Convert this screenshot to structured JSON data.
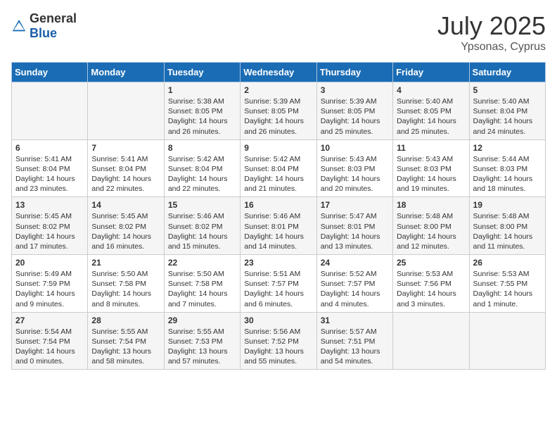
{
  "header": {
    "logo_general": "General",
    "logo_blue": "Blue",
    "month": "July 2025",
    "location": "Ypsonas, Cyprus"
  },
  "days_of_week": [
    "Sunday",
    "Monday",
    "Tuesday",
    "Wednesday",
    "Thursday",
    "Friday",
    "Saturday"
  ],
  "weeks": [
    [
      {
        "day": "",
        "content": ""
      },
      {
        "day": "",
        "content": ""
      },
      {
        "day": "1",
        "sunrise": "Sunrise: 5:38 AM",
        "sunset": "Sunset: 8:05 PM",
        "daylight": "Daylight: 14 hours and 26 minutes."
      },
      {
        "day": "2",
        "sunrise": "Sunrise: 5:39 AM",
        "sunset": "Sunset: 8:05 PM",
        "daylight": "Daylight: 14 hours and 26 minutes."
      },
      {
        "day": "3",
        "sunrise": "Sunrise: 5:39 AM",
        "sunset": "Sunset: 8:05 PM",
        "daylight": "Daylight: 14 hours and 25 minutes."
      },
      {
        "day": "4",
        "sunrise": "Sunrise: 5:40 AM",
        "sunset": "Sunset: 8:05 PM",
        "daylight": "Daylight: 14 hours and 25 minutes."
      },
      {
        "day": "5",
        "sunrise": "Sunrise: 5:40 AM",
        "sunset": "Sunset: 8:04 PM",
        "daylight": "Daylight: 14 hours and 24 minutes."
      }
    ],
    [
      {
        "day": "6",
        "sunrise": "Sunrise: 5:41 AM",
        "sunset": "Sunset: 8:04 PM",
        "daylight": "Daylight: 14 hours and 23 minutes."
      },
      {
        "day": "7",
        "sunrise": "Sunrise: 5:41 AM",
        "sunset": "Sunset: 8:04 PM",
        "daylight": "Daylight: 14 hours and 22 minutes."
      },
      {
        "day": "8",
        "sunrise": "Sunrise: 5:42 AM",
        "sunset": "Sunset: 8:04 PM",
        "daylight": "Daylight: 14 hours and 22 minutes."
      },
      {
        "day": "9",
        "sunrise": "Sunrise: 5:42 AM",
        "sunset": "Sunset: 8:04 PM",
        "daylight": "Daylight: 14 hours and 21 minutes."
      },
      {
        "day": "10",
        "sunrise": "Sunrise: 5:43 AM",
        "sunset": "Sunset: 8:03 PM",
        "daylight": "Daylight: 14 hours and 20 minutes."
      },
      {
        "day": "11",
        "sunrise": "Sunrise: 5:43 AM",
        "sunset": "Sunset: 8:03 PM",
        "daylight": "Daylight: 14 hours and 19 minutes."
      },
      {
        "day": "12",
        "sunrise": "Sunrise: 5:44 AM",
        "sunset": "Sunset: 8:03 PM",
        "daylight": "Daylight: 14 hours and 18 minutes."
      }
    ],
    [
      {
        "day": "13",
        "sunrise": "Sunrise: 5:45 AM",
        "sunset": "Sunset: 8:02 PM",
        "daylight": "Daylight: 14 hours and 17 minutes."
      },
      {
        "day": "14",
        "sunrise": "Sunrise: 5:45 AM",
        "sunset": "Sunset: 8:02 PM",
        "daylight": "Daylight: 14 hours and 16 minutes."
      },
      {
        "day": "15",
        "sunrise": "Sunrise: 5:46 AM",
        "sunset": "Sunset: 8:02 PM",
        "daylight": "Daylight: 14 hours and 15 minutes."
      },
      {
        "day": "16",
        "sunrise": "Sunrise: 5:46 AM",
        "sunset": "Sunset: 8:01 PM",
        "daylight": "Daylight: 14 hours and 14 minutes."
      },
      {
        "day": "17",
        "sunrise": "Sunrise: 5:47 AM",
        "sunset": "Sunset: 8:01 PM",
        "daylight": "Daylight: 14 hours and 13 minutes."
      },
      {
        "day": "18",
        "sunrise": "Sunrise: 5:48 AM",
        "sunset": "Sunset: 8:00 PM",
        "daylight": "Daylight: 14 hours and 12 minutes."
      },
      {
        "day": "19",
        "sunrise": "Sunrise: 5:48 AM",
        "sunset": "Sunset: 8:00 PM",
        "daylight": "Daylight: 14 hours and 11 minutes."
      }
    ],
    [
      {
        "day": "20",
        "sunrise": "Sunrise: 5:49 AM",
        "sunset": "Sunset: 7:59 PM",
        "daylight": "Daylight: 14 hours and 9 minutes."
      },
      {
        "day": "21",
        "sunrise": "Sunrise: 5:50 AM",
        "sunset": "Sunset: 7:58 PM",
        "daylight": "Daylight: 14 hours and 8 minutes."
      },
      {
        "day": "22",
        "sunrise": "Sunrise: 5:50 AM",
        "sunset": "Sunset: 7:58 PM",
        "daylight": "Daylight: 14 hours and 7 minutes."
      },
      {
        "day": "23",
        "sunrise": "Sunrise: 5:51 AM",
        "sunset": "Sunset: 7:57 PM",
        "daylight": "Daylight: 14 hours and 6 minutes."
      },
      {
        "day": "24",
        "sunrise": "Sunrise: 5:52 AM",
        "sunset": "Sunset: 7:57 PM",
        "daylight": "Daylight: 14 hours and 4 minutes."
      },
      {
        "day": "25",
        "sunrise": "Sunrise: 5:53 AM",
        "sunset": "Sunset: 7:56 PM",
        "daylight": "Daylight: 14 hours and 3 minutes."
      },
      {
        "day": "26",
        "sunrise": "Sunrise: 5:53 AM",
        "sunset": "Sunset: 7:55 PM",
        "daylight": "Daylight: 14 hours and 1 minute."
      }
    ],
    [
      {
        "day": "27",
        "sunrise": "Sunrise: 5:54 AM",
        "sunset": "Sunset: 7:54 PM",
        "daylight": "Daylight: 14 hours and 0 minutes."
      },
      {
        "day": "28",
        "sunrise": "Sunrise: 5:55 AM",
        "sunset": "Sunset: 7:54 PM",
        "daylight": "Daylight: 13 hours and 58 minutes."
      },
      {
        "day": "29",
        "sunrise": "Sunrise: 5:55 AM",
        "sunset": "Sunset: 7:53 PM",
        "daylight": "Daylight: 13 hours and 57 minutes."
      },
      {
        "day": "30",
        "sunrise": "Sunrise: 5:56 AM",
        "sunset": "Sunset: 7:52 PM",
        "daylight": "Daylight: 13 hours and 55 minutes."
      },
      {
        "day": "31",
        "sunrise": "Sunrise: 5:57 AM",
        "sunset": "Sunset: 7:51 PM",
        "daylight": "Daylight: 13 hours and 54 minutes."
      },
      {
        "day": "",
        "content": ""
      },
      {
        "day": "",
        "content": ""
      }
    ]
  ]
}
